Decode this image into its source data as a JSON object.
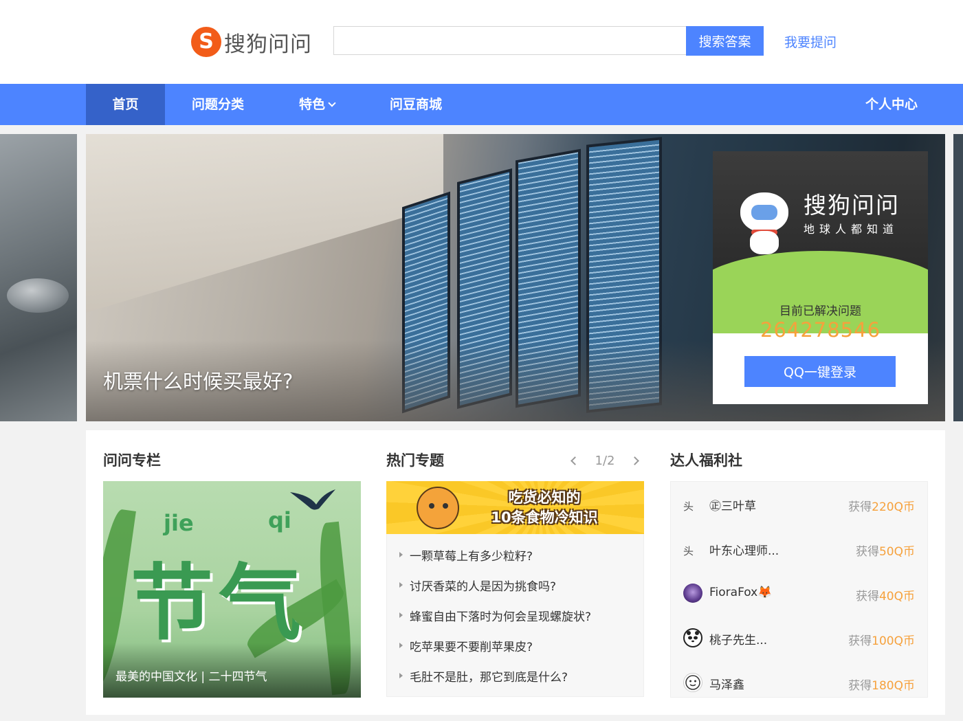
{
  "header": {
    "logo_text": "搜狗问问",
    "logo_mark": "S",
    "search": {
      "placeholder": "",
      "value": "",
      "button_label": "搜索答案"
    },
    "ask_link": "我要提问"
  },
  "nav": {
    "items": [
      {
        "label": "首页",
        "active": true
      },
      {
        "label": "问题分类",
        "active": false
      },
      {
        "label": "特色",
        "active": false,
        "has_dropdown": true
      },
      {
        "label": "问豆商城",
        "active": false
      }
    ],
    "user_center": "个人中心"
  },
  "banner": {
    "caption": "机票什么时候买最好?"
  },
  "login_card": {
    "brand_title": "搜狗问问",
    "brand_slogan": "地球人都知道",
    "solved_label": "目前已解决问题",
    "solved_count": "264278546",
    "qq_login_label": "QQ一键登录"
  },
  "columns": {
    "zhuanlan": {
      "title": "问问专栏",
      "card_pinyin_1": "jie",
      "card_pinyin_2": "qi",
      "card_big_text": "节气",
      "card_caption": "最美的中国文化 | 二十四节气"
    },
    "hot_topics": {
      "title": "热门专题",
      "page": "1/2",
      "banner_line1": "吃货必知的",
      "banner_line2": "10条食物冷知识",
      "items": [
        "一颗草莓上有多少粒籽?",
        "讨厌香菜的人是因为挑食吗?",
        "蜂蜜自由下落时为何会呈现螺旋状?",
        "吃苹果要不要削苹果皮?",
        "毛肚不是肚，那它到底是什么?"
      ]
    },
    "welfare": {
      "title": "达人福利社",
      "reward_prefix": "获得",
      "reward_suffix": "Q币",
      "rows": [
        {
          "name": "㊣三叶草",
          "amount": "220",
          "avatar": "头"
        },
        {
          "name": "叶东心理师...",
          "amount": "50",
          "avatar": "头"
        },
        {
          "name": "FioraFox🦊",
          "amount": "40",
          "avatar": ""
        },
        {
          "name": "桃子先生...",
          "amount": "100",
          "avatar": ""
        },
        {
          "name": "马泽鑫",
          "amount": "180",
          "avatar": ""
        }
      ]
    }
  },
  "colors": {
    "primary": "#4d84ff",
    "nav_active": "#3562c9",
    "accent_orange": "#f6a13c",
    "logo_orange": "#f25c19"
  }
}
